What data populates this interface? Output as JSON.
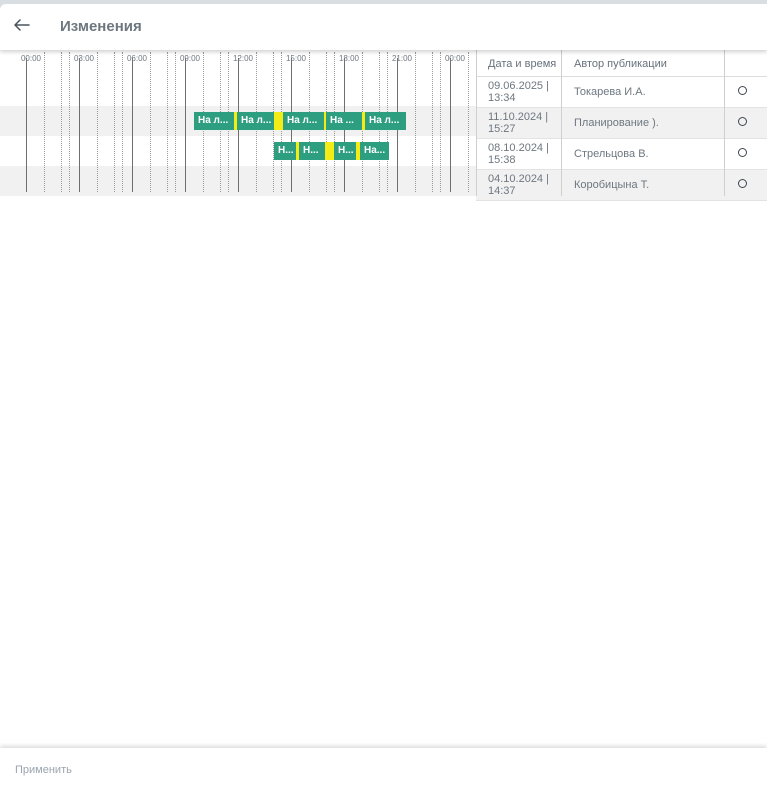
{
  "header": {
    "title": "Изменения",
    "back_icon": "arrow-left-icon"
  },
  "timeline": {
    "hour_labels": [
      "00:00",
      "03:00",
      "06:00",
      "09:00",
      "12:00",
      "15:00",
      "18:00",
      "21:00",
      "00:00"
    ],
    "colors": {
      "event": "#2e9e80",
      "gap": "#f4ec16",
      "row_alt": "#f1f1f1"
    },
    "rows": [
      {
        "events": []
      },
      {
        "events": [
          {
            "label": "На л..."
          },
          {
            "label": "На л..."
          },
          {
            "label": "На л..."
          },
          {
            "label": "На ..."
          },
          {
            "label": "На л..."
          }
        ]
      },
      {
        "events": [
          {
            "label": "Н..."
          },
          {
            "label": "Н..."
          },
          {
            "label": "Н..."
          },
          {
            "label": "На..."
          }
        ]
      },
      {
        "events": []
      }
    ]
  },
  "table": {
    "headers": {
      "datetime": "Дата и время",
      "author": "Автор публикации"
    },
    "rows": [
      {
        "date": "09.06.2025 |",
        "time": "13:34",
        "author": "Токарева И.А."
      },
      {
        "date": "11.10.2024 |",
        "time": "15:27",
        "author": "Планирование )."
      },
      {
        "date": "08.10.2024 |",
        "time": "15:38",
        "author": "Стрельцова В."
      },
      {
        "date": "04.10.2024 |",
        "time": "14:37",
        "author": "Коробицына Т."
      }
    ]
  },
  "footer": {
    "apply_label": "Применить"
  }
}
